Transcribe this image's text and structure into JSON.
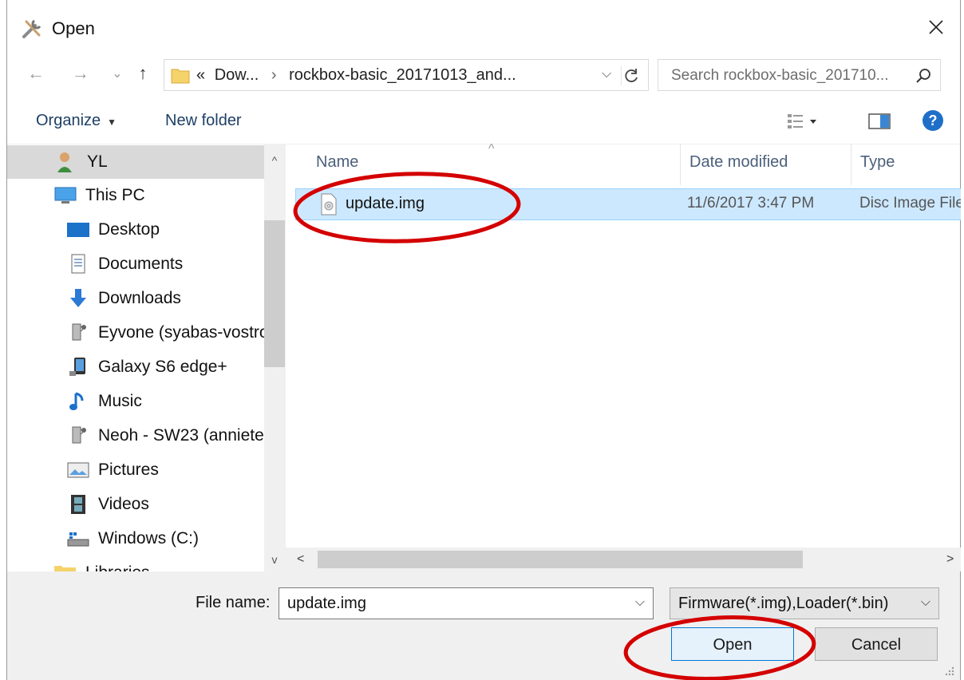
{
  "window": {
    "title": "Open",
    "close_glyph": "✕"
  },
  "nav": {
    "back_glyph": "←",
    "forward_glyph": "→",
    "recent_glyph": "⌄",
    "up_glyph": "↑",
    "address": {
      "prefix": "«",
      "crumb1": "Dow...",
      "separator": "›",
      "crumb2": "rockbox-basic_20171013_and...",
      "dropdown_glyph": "⌵"
    },
    "search_placeholder": "Search rockbox-basic_201710..."
  },
  "toolbar": {
    "organize_label": "Organize",
    "caret_glyph": "▼",
    "new_folder_label": "New folder"
  },
  "sidebar": {
    "scroll_up_glyph": "^",
    "scroll_down_glyph": "v",
    "items": [
      {
        "label": "YL",
        "icon": "user-icon"
      },
      {
        "label": "This PC",
        "icon": "computer-icon"
      },
      {
        "label": "Desktop",
        "icon": "desktop-icon"
      },
      {
        "label": "Documents",
        "icon": "documents-icon"
      },
      {
        "label": "Downloads",
        "icon": "downloads-icon"
      },
      {
        "label": "Eyvone (syabas-vostro",
        "icon": "network-user-icon"
      },
      {
        "label": "Galaxy S6 edge+",
        "icon": "phone-icon"
      },
      {
        "label": "Music",
        "icon": "music-icon"
      },
      {
        "label": "Neoh - SW23 (anniete",
        "icon": "network-user-icon"
      },
      {
        "label": "Pictures",
        "icon": "pictures-icon"
      },
      {
        "label": "Videos",
        "icon": "videos-icon"
      },
      {
        "label": "Windows (C:)",
        "icon": "drive-icon"
      },
      {
        "label": "Libraries",
        "icon": "libraries-icon"
      }
    ]
  },
  "filelist": {
    "columns": {
      "name": "Name",
      "date": "Date modified",
      "type": "Type"
    },
    "sort_glyph": "^",
    "files": [
      {
        "name": "update.img",
        "date": "11/6/2017 3:47 PM",
        "type": "Disc Image File"
      }
    ],
    "hscroll_left_glyph": "<",
    "hscroll_right_glyph": ">"
  },
  "bottom": {
    "file_name_label": "File name:",
    "file_name_value": "update.img",
    "dropdown_glyph": "⌵",
    "filter_value": "Firmware(*.img),Loader(*.bin)",
    "open_label": "Open",
    "cancel_label": "Cancel"
  },
  "colors": {
    "selection": "#cce8ff",
    "annotation": "#d40000",
    "accent": "#0078d7"
  }
}
